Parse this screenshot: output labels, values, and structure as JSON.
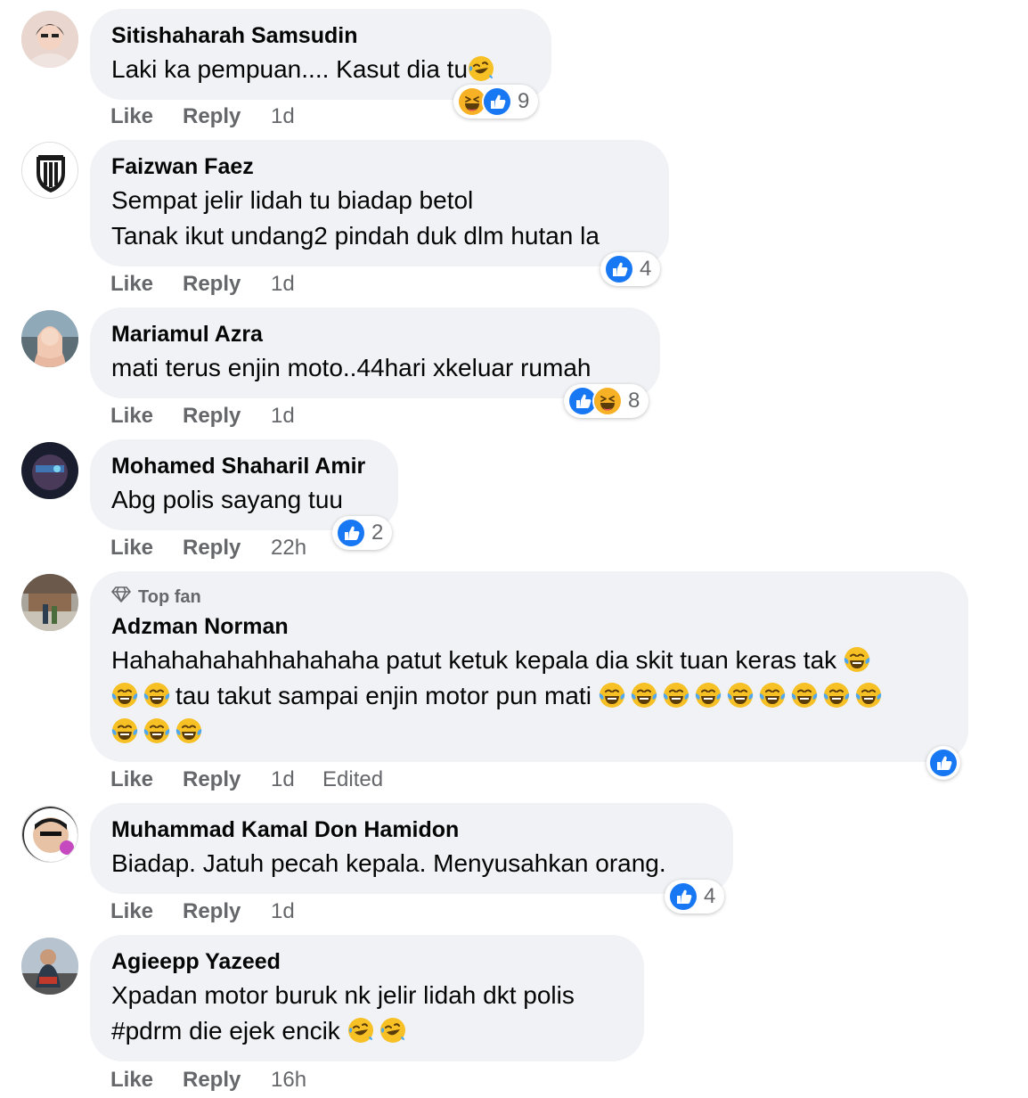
{
  "colors": {
    "bubble": "#f0f2f5",
    "secondary_text": "#65676b",
    "like_blue": "#1877f2",
    "haha_yellow": "#f7b125"
  },
  "labels": {
    "like": "Like",
    "reply": "Reply",
    "edited": "Edited",
    "top_fan": "Top fan"
  },
  "comments": [
    {
      "author": "Sitishaharah Samsudin",
      "lines": [
        "Laki ka pempuan.... Kasut dia tu"
      ],
      "time": "1d",
      "reactions": [
        "haha-icon",
        "like-icon"
      ],
      "reaction_count": "9"
    },
    {
      "author": "Faizwan Faez",
      "lines": [
        "Sempat jelir lidah tu biadap betol",
        "Tanak ikut undang2 pindah duk dlm hutan la"
      ],
      "time": "1d",
      "reactions": [
        "like-icon"
      ],
      "reaction_count": "4"
    },
    {
      "author": "Mariamul Azra",
      "lines": [
        "mati terus enjin moto..44hari xkeluar rumah"
      ],
      "time": "1d",
      "reactions": [
        "like-icon",
        "haha-icon"
      ],
      "reaction_count": "8"
    },
    {
      "author": "Mohamed Shaharil Amir",
      "lines": [
        "Abg polis sayang tuu"
      ],
      "time": "22h",
      "reactions": [
        "like-icon"
      ],
      "reaction_count": "2"
    },
    {
      "author": "Adzman Norman",
      "top_fan": true,
      "lines": [
        "Hahahahahahhahahaha patut ketuk kepala dia skit tuan keras tak",
        "tau takut sampai enjin motor pun mati"
      ],
      "time": "1d",
      "edited": true,
      "reactions": [
        "like-icon"
      ],
      "reaction_count": ""
    },
    {
      "author": "Muhammad Kamal Don Hamidon",
      "lines": [
        "Biadap. Jatuh pecah kepala. Menyusahkan orang."
      ],
      "time": "1d",
      "reactions": [
        "like-icon"
      ],
      "reaction_count": "4"
    },
    {
      "author": "Agieepp Yazeed",
      "lines": [
        "Xpadan motor buruk nk jelir lidah dkt polis",
        "#pdrm die ejek encik"
      ],
      "time": "16h",
      "reactions": [],
      "reaction_count": ""
    }
  ]
}
